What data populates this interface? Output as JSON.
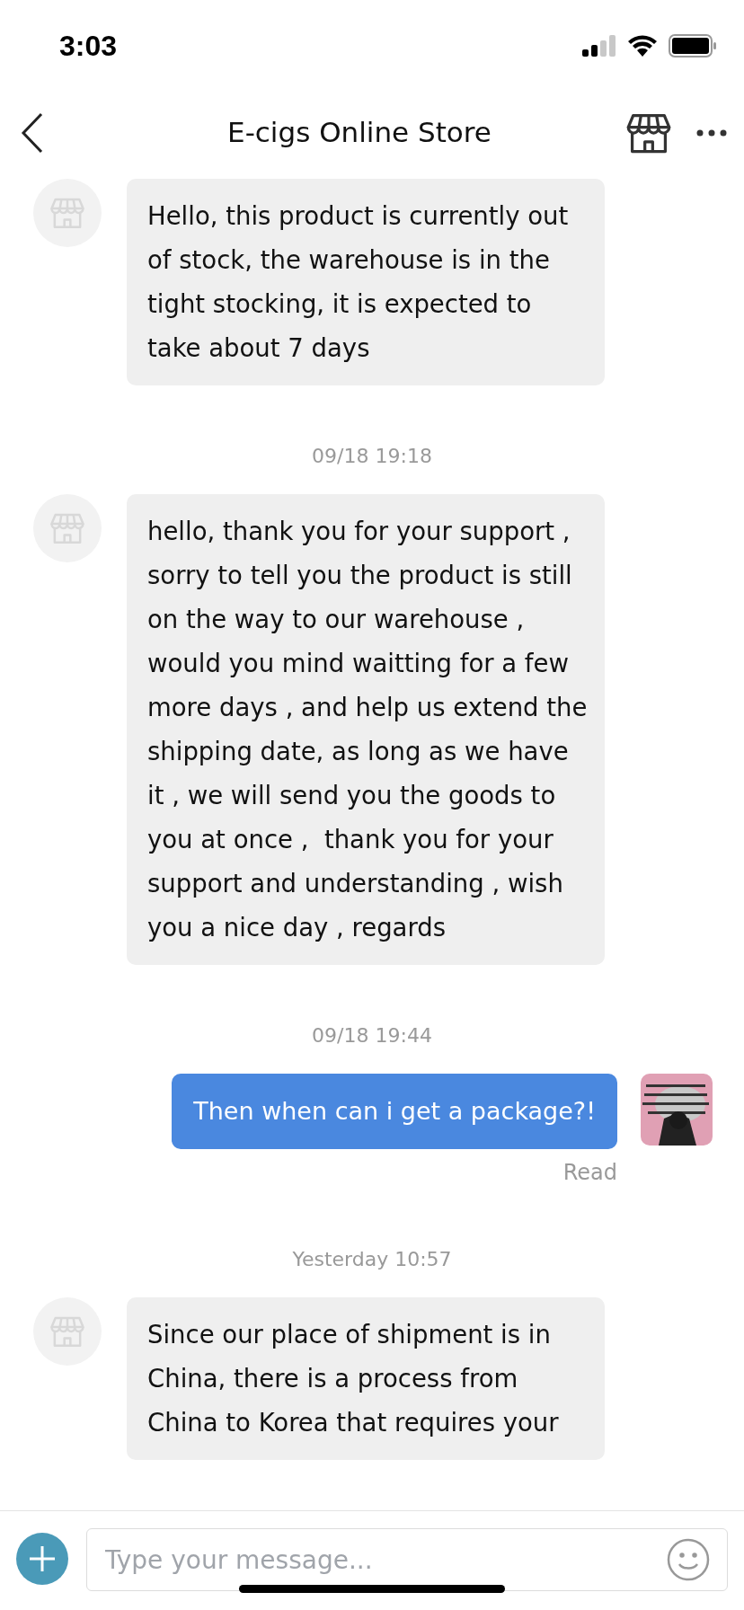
{
  "status_bar": {
    "time": "3:03"
  },
  "header": {
    "title": "E-cigs Online Store"
  },
  "messages": [
    {
      "kind": "incoming",
      "text": "Hello, this product is currently out of stock, the warehouse is in the tight stocking, it is expected to take about 7 days"
    },
    {
      "kind": "timestamp",
      "text": "09/18 19:18"
    },
    {
      "kind": "incoming",
      "text": "hello, thank you for your support , sorry to tell you the product is still on the way to our warehouse , would you mind waitting for a few more days , and help us extend the shipping date, as long as we have it , we will send you the goods to you at once ,  thank you for your support and understanding , wish you a nice day , regards"
    },
    {
      "kind": "timestamp",
      "text": "09/18 19:44"
    },
    {
      "kind": "outgoing",
      "text": "Then when can i get a package?!",
      "status": "Read"
    },
    {
      "kind": "timestamp",
      "text": "Yesterday 10:57"
    },
    {
      "kind": "incoming",
      "text": "Since our place of shipment is in China, there is a process from China to Korea that requires your"
    }
  ],
  "composer": {
    "placeholder": "Type your message..."
  }
}
